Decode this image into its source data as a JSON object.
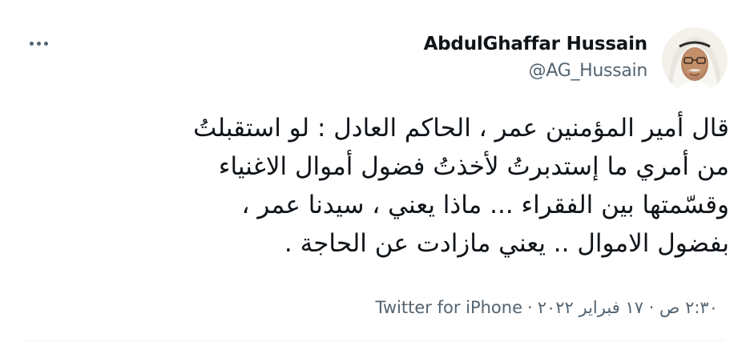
{
  "tweet": {
    "author": {
      "display_name": "AbdulGhaffar Hussain",
      "handle": "@AG_Hussain"
    },
    "body_lines": [
      "قال أمير المؤمنين عمر ، الحاكم العادل : لو استقبلتُ",
      "من أمري ما إستدبرتُ لأخذتُ فضول أموال الاغنياء",
      "وقسّمتها بين الفقراء ... ماذا يعني ، سيدنا عمر ،",
      "بفضول الاموال .. يعني مازادت عن الحاجة  ."
    ],
    "timestamp": "٢:٣٠ ص · ١٧ فبراير ٢٠٢٢",
    "separator": "·",
    "source": "Twitter for iPhone"
  },
  "icons": {
    "more": "more-horizontal-icon"
  },
  "colors": {
    "text_primary": "#0f1419",
    "text_secondary": "#536471",
    "divider": "#eff3f4"
  }
}
